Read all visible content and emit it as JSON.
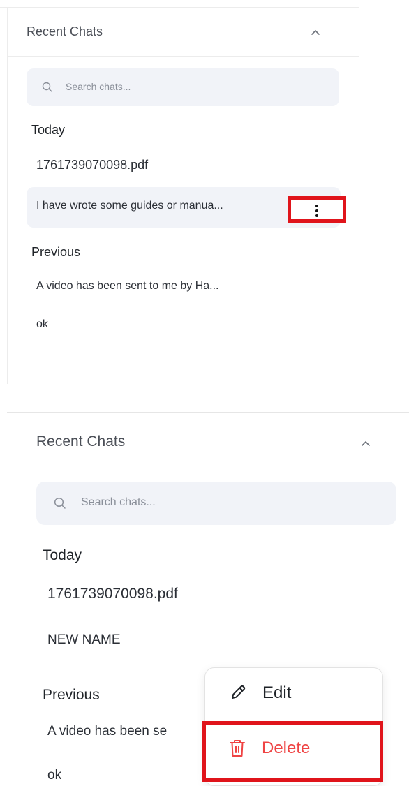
{
  "panel_before": {
    "header": {
      "title": "Recent Chats"
    },
    "search": {
      "placeholder": "Search chats..."
    },
    "sections": {
      "today": {
        "label": "Today",
        "items": [
          "1761739070098.pdf",
          "I have wrote some guides or manua..."
        ]
      },
      "previous": {
        "label": "Previous",
        "items": [
          "A video has been sent to me by Ha...",
          "ok"
        ]
      }
    }
  },
  "panel_after": {
    "header": {
      "title": "Recent Chats"
    },
    "search": {
      "placeholder": "Search chats..."
    },
    "sections": {
      "today": {
        "label": "Today",
        "items": [
          "1761739070098.pdf",
          "NEW NAME"
        ]
      },
      "previous": {
        "label": "Previous",
        "items": [
          "A video has been se",
          "ok"
        ]
      }
    },
    "context_menu": {
      "edit_label": "Edit",
      "delete_label": "Delete"
    }
  },
  "colors": {
    "highlight_border": "#e0141b",
    "delete_text": "#ef4444",
    "search_bg": "#f1f3f8"
  },
  "icons": [
    "chevron-up-icon",
    "search-icon",
    "more-vertical-icon",
    "pencil-icon",
    "trash-icon"
  ]
}
